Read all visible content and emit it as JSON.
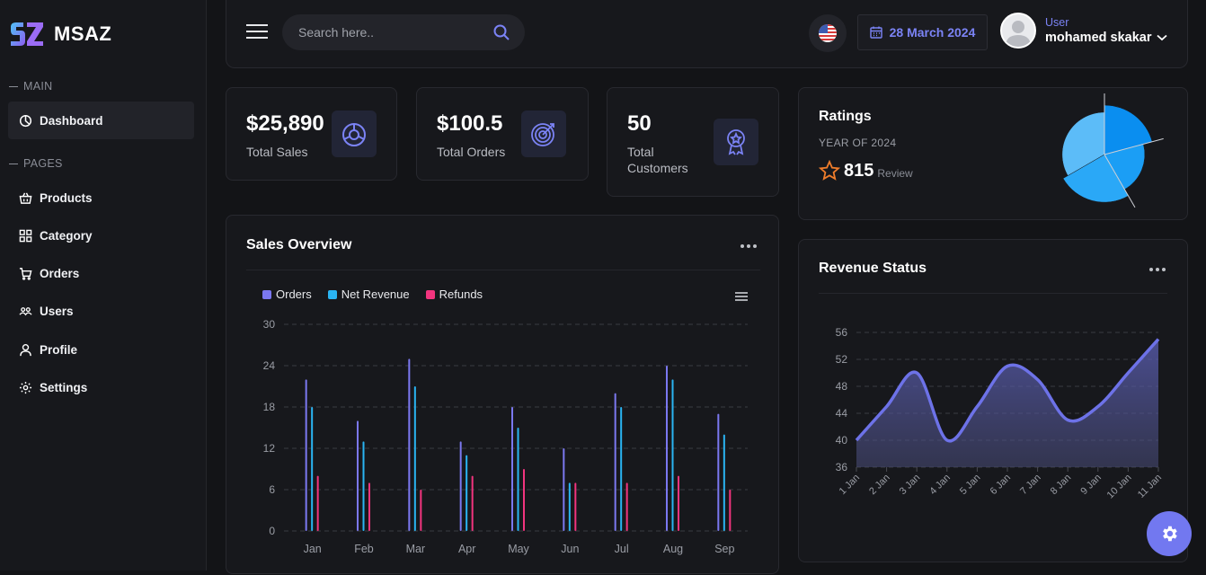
{
  "brand": {
    "name": "MSAZ"
  },
  "sidebar": {
    "main_label": "MAIN",
    "pages_label": "PAGES",
    "dashboard": "Dashboard",
    "items": [
      "Products",
      "Category",
      "Orders",
      "Users",
      "Profile",
      "Settings"
    ]
  },
  "topbar": {
    "search_placeholder": "Search here..",
    "date": "28 March 2024",
    "user_role": "User",
    "user_name": "mohamed skakar"
  },
  "stats": {
    "sales_value": "$25,890",
    "sales_label": "Total Sales",
    "orders_value": "$100.5",
    "orders_label": "Total Orders",
    "customers_value": "50",
    "customers_label": "Total Customers"
  },
  "ratings": {
    "title": "Ratings",
    "subtitle": "YEAR OF 2024",
    "value": "815",
    "unit": "Review"
  },
  "colors": {
    "accent": "#7b83f5",
    "orders": "#7b78f0",
    "net_revenue": "#2ab4f2",
    "refunds": "#f2347e",
    "area_line": "#6d72e8"
  },
  "chart_data": [
    {
      "title": "Sales Overview",
      "type": "bar",
      "categories": [
        "Jan",
        "Feb",
        "Mar",
        "Apr",
        "May",
        "Jun",
        "Jul",
        "Aug",
        "Sep"
      ],
      "series": [
        {
          "name": "Orders",
          "values": [
            22,
            16,
            25,
            13,
            18,
            12,
            20,
            24,
            17
          ]
        },
        {
          "name": "Net Revenue",
          "values": [
            18,
            13,
            21,
            11,
            15,
            7,
            18,
            22,
            14
          ]
        },
        {
          "name": "Refunds",
          "values": [
            8,
            7,
            6,
            8,
            9,
            7,
            7,
            8,
            6
          ]
        }
      ],
      "yticks": [
        0,
        6,
        12,
        18,
        24,
        30
      ],
      "ylim": [
        0,
        30
      ],
      "grid": true,
      "legend": "top-left"
    },
    {
      "title": "Revenue Status",
      "type": "area",
      "x": [
        "1 Jan",
        "2 Jan",
        "3 Jan",
        "4 Jan",
        "5 Jan",
        "6 Jan",
        "7 Jan",
        "8 Jan",
        "9 Jan",
        "10 Jan",
        "11 Jan"
      ],
      "values": [
        40,
        45,
        50,
        40,
        45,
        51,
        49,
        43,
        45,
        50,
        55
      ],
      "yticks": [
        36,
        40,
        44,
        48,
        52,
        56
      ],
      "ylim": [
        36,
        56
      ],
      "grid": true
    },
    {
      "title": "Ratings",
      "type": "pie",
      "values": [
        30,
        20,
        28,
        22
      ]
    }
  ]
}
